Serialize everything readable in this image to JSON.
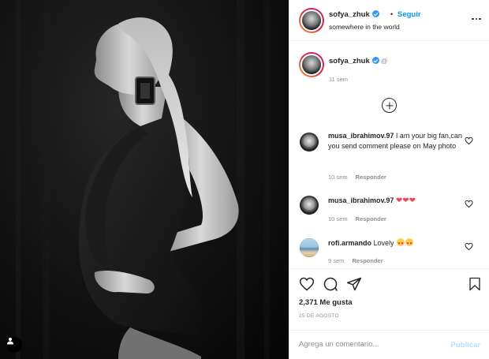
{
  "header": {
    "username": "sofya_zhuk",
    "separator": "•",
    "follow_label": "Seguir",
    "location": "somewhere in the world"
  },
  "caption": {
    "username": "sofya_zhuk",
    "mention_glyph": "@",
    "time": "11 sem"
  },
  "comments": [
    {
      "user": "musa_ibrahimov.97",
      "text": "I am your big fan,can you send comment please on May photo",
      "time": "10 sem",
      "reply_label": "Responder"
    },
    {
      "user": "musa_ibrahimov.97",
      "text": "❤❤❤",
      "time": "10 sem",
      "reply_label": "Responder"
    },
    {
      "user": "rofi.armando",
      "text": "Lovely",
      "time": "9 sem",
      "reply_label": "Responder"
    }
  ],
  "actions": {
    "likes": "2,371 Me gusta",
    "date": "25 DE AGOSTO"
  },
  "add_comment": {
    "placeholder": "Agrega un comentario...",
    "post_label": "Publicar"
  },
  "colors": {
    "accent": "#0095f6",
    "post_disabled": "#b2dffc",
    "verified": "#3897f0",
    "heart": "#ed4956"
  },
  "icons": [
    "verified-icon",
    "more-options-icon",
    "load-more-comments-icon",
    "heart-icon",
    "comment-icon",
    "share-icon",
    "save-icon",
    "user-tag-icon"
  ]
}
